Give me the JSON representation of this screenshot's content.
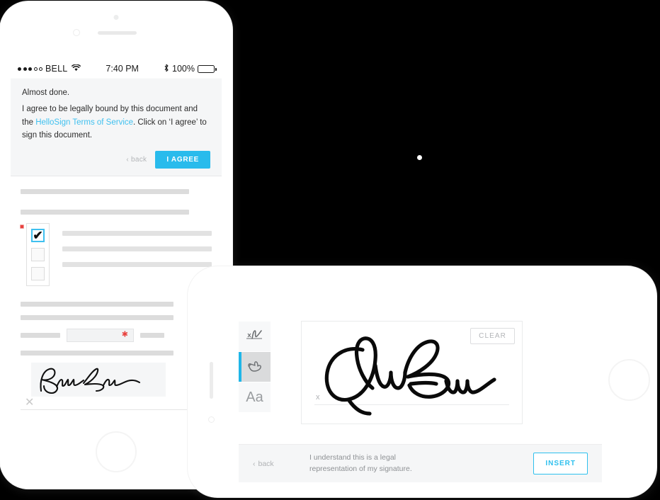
{
  "background_color": "#000000",
  "accent_color": "#29bbec",
  "portrait_phone": {
    "status_bar": {
      "carrier": "BELL",
      "signal_dots_filled": 3,
      "signal_dots_empty": 2,
      "wifi_icon": "wifi-icon",
      "time": "7:40 PM",
      "bluetooth_icon": "bluetooth-icon",
      "battery_percent": "100%",
      "battery_icon": "battery-full-icon"
    },
    "agreement": {
      "title": "Almost done.",
      "body_before_link": "I agree to be legally bound by this document and the ",
      "link_text": "HelloSign Terms of Service",
      "body_after_link": ". Click on ‘I agree’ to sign this document.",
      "back_label": "back",
      "agree_label": "I AGREE",
      "link_color": "#3fc0ef",
      "agree_button_color": "#29bbec"
    },
    "document": {
      "required_marker_color": "#e8423f",
      "checkbox_group": {
        "options": [
          {
            "checked": true
          },
          {
            "checked": false
          },
          {
            "checked": false
          }
        ],
        "checked_border_color": "#3fc0ef"
      },
      "signature_field": {
        "signature_name": "Bruce Wayne",
        "remove_icon": "close-x-icon"
      }
    }
  },
  "landscape_phone": {
    "toolbar": {
      "items": [
        {
          "icon": "draw-signature-icon",
          "label": "",
          "active": false
        },
        {
          "icon": "hand-draw-icon",
          "label": "",
          "active": true
        },
        {
          "icon": "type-text-icon",
          "label": "Aa",
          "active": false
        }
      ],
      "active_indicator_color": "#1fb6e8"
    },
    "signature_pad": {
      "clear_label": "CLEAR",
      "baseline_x_marker": "x",
      "signature_name": "Jon Brown"
    },
    "footer": {
      "back_label": "back",
      "legal_line_1": "I understand this is a legal",
      "legal_line_2": "representation of my signature.",
      "insert_label": "INSERT",
      "insert_color": "#2ec0ee"
    }
  }
}
